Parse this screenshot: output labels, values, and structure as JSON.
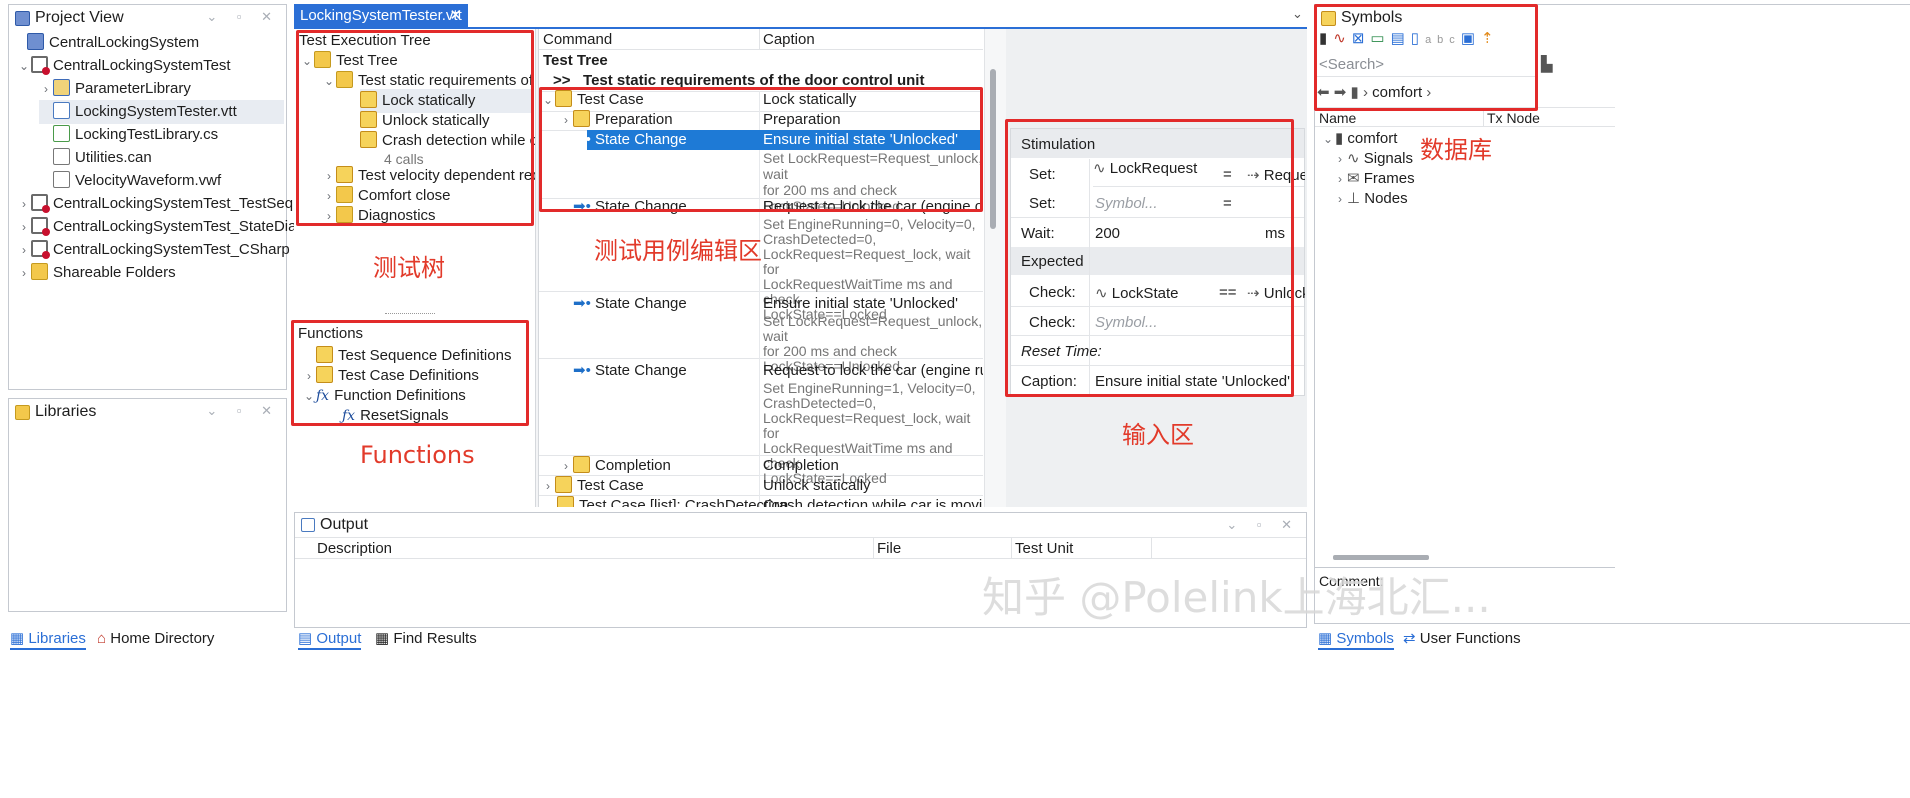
{
  "project_view": {
    "title": "Project View",
    "items": [
      {
        "label": "CentralLockingSystem",
        "icon": "project-icon"
      },
      {
        "label": "CentralLockingSystemTest",
        "icon": "test-unit-icon"
      },
      {
        "label": "ParameterLibrary",
        "icon": "library-icon"
      },
      {
        "label": "LockingSystemTester.vtt",
        "icon": "vtt-file-icon"
      },
      {
        "label": "LockingTestLibrary.cs",
        "icon": "cs-file-icon"
      },
      {
        "label": "Utilities.can",
        "icon": "can-file-icon"
      },
      {
        "label": "VelocityWaveform.vwf",
        "icon": "waveform-file-icon"
      },
      {
        "label": "CentralLockingSystemTest_TestSequen...",
        "icon": "test-unit-icon"
      },
      {
        "label": "CentralLockingSystemTest_StateDiagram",
        "icon": "test-unit-icon"
      },
      {
        "label": "CentralLockingSystemTest_CSharp",
        "icon": "test-unit-icon"
      },
      {
        "label": "Shareable Folders",
        "icon": "shared-folder-icon"
      }
    ]
  },
  "libraries": {
    "title": "Libraries"
  },
  "left_tabs": {
    "libraries": "Libraries",
    "home": "Home Directory"
  },
  "editor_tab": {
    "label": "LockingSystemTester.vtt"
  },
  "test_tree": {
    "title": "Test Execution Tree",
    "items": [
      "Test Tree",
      "Test static requirements of t...",
      "Lock statically",
      "Unlock statically",
      "Crash detection while car...",
      "4 calls",
      "Test velocity dependent req...",
      "Comfort close",
      "Diagnostics"
    ]
  },
  "functions": {
    "title": "Functions",
    "items": [
      "Test Sequence Definitions",
      "Test Case Definitions",
      "Function Definitions",
      "ResetSignals"
    ]
  },
  "command_table": {
    "headers": [
      "Command",
      "Caption"
    ],
    "root": "Test Tree",
    "group": ">>   Test static requirements of the door control unit",
    "rows": [
      {
        "cmd": "Test Case",
        "caption": "Lock statically"
      },
      {
        "cmd": "Preparation",
        "caption": "Preparation"
      },
      {
        "cmd": "State Change",
        "caption": "Ensure initial state 'Unlocked'",
        "detail": [
          "Set LockRequest=Request_unlock, wait",
          "for 200 ms and check",
          "LockState==Unlocked"
        ]
      },
      {
        "cmd": "State Change",
        "caption": "Request to lock the car (engine off). C...",
        "detail": [
          "Set EngineRunning=0, Velocity=0,",
          "CrashDetected=0,",
          "LockRequest=Request_lock, wait for",
          "LockRequestWaitTime ms and check",
          "LockState==Locked"
        ]
      },
      {
        "cmd": "State Change",
        "caption": "Ensure initial state 'Unlocked'",
        "detail": [
          "Set LockRequest=Request_unlock, wait",
          "for 200 ms and check",
          "LockState==Unlocked"
        ]
      },
      {
        "cmd": "State Change",
        "caption": "Request to lock the car (engine runnin...",
        "detail": [
          "Set EngineRunning=1, Velocity=0,",
          "CrashDetected=0,",
          "LockRequest=Request_lock, wait for",
          "LockRequestWaitTime ms and check",
          "LockState==Locked"
        ]
      },
      {
        "cmd": "Completion",
        "caption": "Completion"
      },
      {
        "cmd": "Test Case",
        "caption": "Unlock statically"
      },
      {
        "cmd": "Test Case [list]: CrashDetection...",
        "caption": "Crash detection while car is moving..."
      }
    ]
  },
  "input_form": {
    "stimulation": "Stimulation",
    "set1_label": "Set:",
    "set1_signal": "LockRequest",
    "set1_op": "=",
    "set1_value": "Reques",
    "set2_label": "Set:",
    "set2_placeholder": "Symbol...",
    "set2_op": "=",
    "wait_label": "Wait:",
    "wait_value": "200",
    "wait_unit": "ms",
    "expected": "Expected",
    "check1_label": "Check:",
    "check1_signal": "LockState",
    "check1_op": "==",
    "check1_value": "Unlock",
    "check2_label": "Check:",
    "check2_placeholder": "Symbol...",
    "reset_label": "Reset Time:",
    "caption_label": "Caption:",
    "caption_value": "Ensure initial state 'Unlocked'"
  },
  "output": {
    "title": "Output",
    "headers": [
      "Description",
      "File",
      "Test Unit"
    ],
    "tabs": [
      "Output",
      "Find Results"
    ]
  },
  "symbols": {
    "title": "Symbols",
    "search_placeholder": "<Search>",
    "breadcrumb": "comfort",
    "headers": [
      "Name",
      "Tx Node"
    ],
    "tree": [
      "comfort",
      "Signals",
      "Frames",
      "Nodes"
    ],
    "comment": "Comment:",
    "tabs": [
      "Symbols",
      "User Functions"
    ]
  },
  "annotations": {
    "test_tree": "测试树",
    "functions": "Functions",
    "editor": "测试用例编辑区",
    "input": "输入区",
    "database": "数据库",
    "watermark": "知乎 @Polelink上海北汇..."
  },
  "colors": {
    "selection": "#1e7ad6",
    "annotation": "#e22a2a",
    "accent": "#2b6fd6"
  }
}
